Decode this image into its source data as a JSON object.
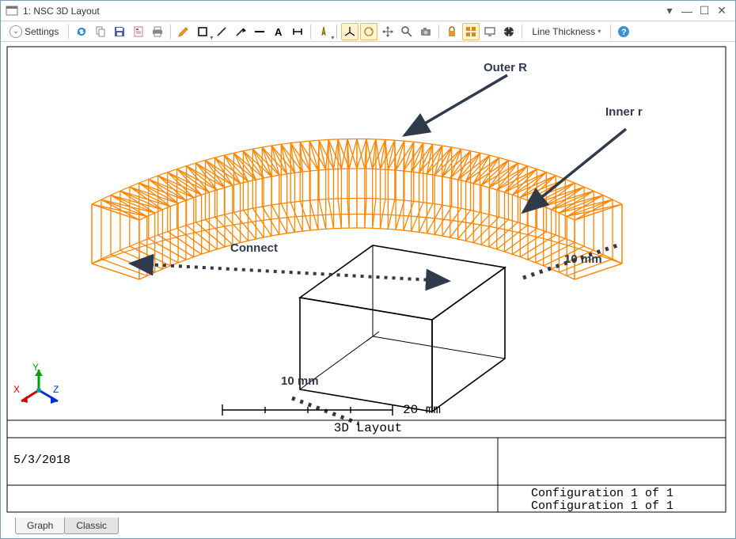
{
  "window": {
    "title": "1: NSC 3D Layout"
  },
  "toolbar": {
    "settings_label": "Settings",
    "line_thickness_label": "Line Thickness"
  },
  "annotations": {
    "outer_r": "Outer R",
    "inner_r": "Inner r",
    "connect": "Connect",
    "dim_top": "10 mm",
    "dim_bottom": "10 mm"
  },
  "scale": {
    "label": "20 mm"
  },
  "footer": {
    "caption": "3D Layout",
    "date": "5/3/2018",
    "config_line1": "Configuration 1 of 1",
    "config_line2": "Configuration 1 of 1"
  },
  "axes": {
    "x": "X",
    "y": "Y",
    "z": "Z"
  },
  "tabs": {
    "graph": "Graph",
    "classic": "Classic"
  },
  "icons": {
    "refresh": "refresh-icon",
    "copy": "copy-icon",
    "save": "save-icon",
    "report": "report-icon",
    "print": "print-icon",
    "pencil": "pencil-icon",
    "square": "square-icon",
    "line": "line-icon",
    "arrow": "arrow-icon",
    "dash": "dash-icon",
    "text_a": "text-a-icon",
    "dimension": "dimension-icon",
    "compass": "compass-icon",
    "axes3d": "axes3d-icon",
    "rotate": "rotate-icon",
    "move": "move-icon",
    "zoom": "zoom-icon",
    "camera": "camera-icon",
    "lock": "lock-icon",
    "grid": "grid-icon",
    "monitor": "monitor-icon",
    "target": "target-icon",
    "help": "help-icon"
  }
}
